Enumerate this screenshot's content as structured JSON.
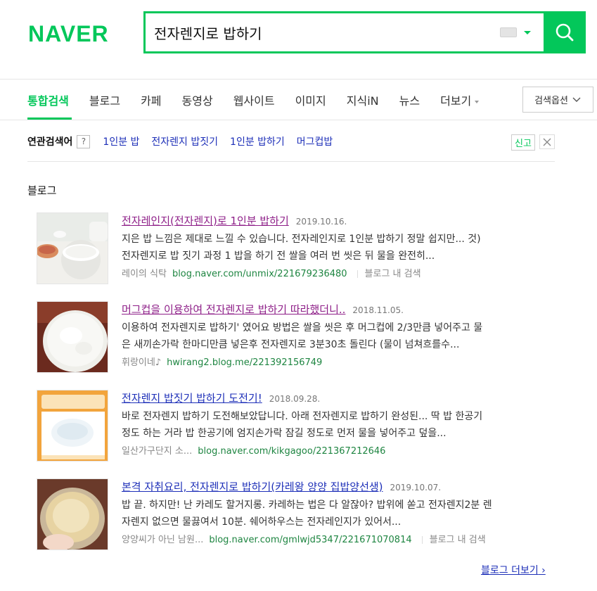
{
  "brand": {
    "logo": "NAVER",
    "accent": "#03c75a"
  },
  "search": {
    "query": "전자렌지로 밥하기"
  },
  "tabs": [
    {
      "label": "통합검색",
      "active": true
    },
    {
      "label": "블로그"
    },
    {
      "label": "카페"
    },
    {
      "label": "동영상"
    },
    {
      "label": "웹사이트"
    },
    {
      "label": "이미지"
    },
    {
      "label": "지식iN"
    },
    {
      "label": "뉴스"
    },
    {
      "label": "더보기"
    }
  ],
  "search_options": "검색옵션",
  "related": {
    "title": "연관검색어",
    "help": "?",
    "items": [
      "1인분 밥",
      "전자렌지 밥짓기",
      "1인분 밥하기",
      "머그컵밥"
    ],
    "report": "신고"
  },
  "blog": {
    "section_title": "블로그",
    "results": [
      {
        "title": "전자레인지(전자렌지)로 1인분 밥하기",
        "date": "2019.10.16.",
        "desc_line1": "지은 밥 느낌은 제대로 느낄 수 있습니다. 전자레인지로 1인분 밥하기 정말 쉽지만... 것)",
        "desc_line2": "전자렌지로 밥 짓기 과정 1 밥을 하기 전 쌀을 여러 번 씻은 뒤 물을 완전히...",
        "author": "레이의 식탁",
        "url": "blog.naver.com/unmix/221679236480",
        "in_blog": "블로그 내 검색"
      },
      {
        "title": "머그컵을 이용하여 전자렌지로 밥하기 따라했더니..",
        "date": "2018.11.05.",
        "desc_line1": "이용하여 전자렌지로 밥하기' 였어요 방법은 쌀을 씻은 후 머그컵에 2/3만큼 넣어주고 물",
        "desc_line2": "은 새끼손가락 한마디만큼 넣은후 전자렌지로 3분30초 돌린다 (물이 넘쳐흐를수...",
        "author": "휘랑이네♪",
        "url": "hwirang2.blog.me/221392156749"
      },
      {
        "title": "전자렌지 밥짓기 밥하기 도전기!",
        "date": "2018.09.28.",
        "desc_line1": "바로 전자렌지 밥하기 도전해보았답니다. 아래 전자렌지로 밥하기 완성된... 딱 밥 한공기",
        "desc_line2": "정도 하는 거라 밥 한공기에 엄지손가락 잠길 정도로 먼저 물을 넣어주고 덮을...",
        "author": "일산가구단지 소...",
        "url": "blog.naver.com/kikgagoo/221367212646"
      },
      {
        "title": "본격 자취요리, 전자렌지로 밥하기(카레왕 양양 집밥양선생)",
        "date": "2019.10.07.",
        "desc_line1": "밥 끝. 하지만! 난 카레도 할거지롱. 카레하는 법은 다 알잖아? 밥위에 쏟고 전자렌지2분 렌",
        "desc_line2": "자렌지 없으면 물끓여서 10분. 쉐어하우스는 전자레인지가 있어서...",
        "author": "양양씨가 아닌 남원...",
        "url": "blog.naver.com/gmlwjd5347/221671070814",
        "in_blog": "블로그 내 검색"
      }
    ],
    "more": "블로그 더보기"
  }
}
